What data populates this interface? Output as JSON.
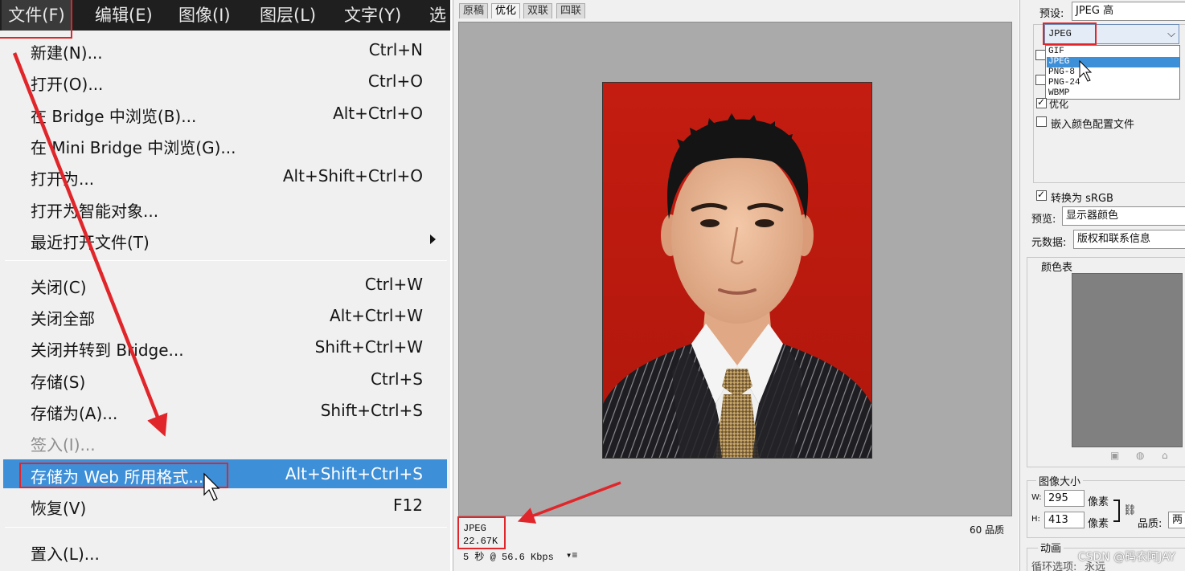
{
  "menubar": {
    "items": [
      "文件(F)",
      "编辑(E)",
      "图像(I)",
      "图层(L)",
      "文字(Y)",
      "选"
    ]
  },
  "file_menu": {
    "items": [
      {
        "label": "新建(N)...",
        "shortcut": "Ctrl+N"
      },
      {
        "label": "打开(O)...",
        "shortcut": "Ctrl+O"
      },
      {
        "label": "在 Bridge 中浏览(B)...",
        "shortcut": "Alt+Ctrl+O"
      },
      {
        "label": "在 Mini Bridge 中浏览(G)...",
        "shortcut": ""
      },
      {
        "label": "打开为...",
        "shortcut": "Alt+Shift+Ctrl+O"
      },
      {
        "label": "打开为智能对象...",
        "shortcut": ""
      },
      {
        "label": "最近打开文件(T)",
        "shortcut": ""
      },
      {
        "label": "关闭(C)",
        "shortcut": "Ctrl+W"
      },
      {
        "label": "关闭全部",
        "shortcut": "Alt+Ctrl+W"
      },
      {
        "label": "关闭并转到 Bridge...",
        "shortcut": "Shift+Ctrl+W"
      },
      {
        "label": "存储(S)",
        "shortcut": "Ctrl+S"
      },
      {
        "label": "存储为(A)...",
        "shortcut": "Shift+Ctrl+S"
      },
      {
        "label": "签入(I)...",
        "shortcut": ""
      },
      {
        "label": "存储为 Web 所用格式...",
        "shortcut": "Alt+Shift+Ctrl+S"
      },
      {
        "label": "恢复(V)",
        "shortcut": "F12"
      },
      {
        "label": "置入(L)...",
        "shortcut": ""
      }
    ]
  },
  "preview": {
    "tabs": [
      "原稿",
      "优化",
      "双联",
      "四联"
    ],
    "active_tab": "优化",
    "format": "JPEG",
    "file_size": "22.67K",
    "download_time": "5 秒 @ 56.6 Kbps",
    "quality_label": "60 品质"
  },
  "settings": {
    "preset_label": "预设:",
    "preset_value": "JPEG 高",
    "format_value": "JPEG",
    "format_options": [
      "GIF",
      "JPEG",
      "PNG-8",
      "PNG-24",
      "WBMP"
    ],
    "optimized_label": "优化",
    "embed_profile_label": "嵌入颜色配置文件",
    "convert_srgb_label": "转换为 sRGB",
    "preview_label": "预览:",
    "preview_value": "显示器颜色",
    "metadata_label": "元数据:",
    "metadata_value": "版权和联系信息",
    "color_table_label": "颜色表",
    "image_size_label": "图像大小",
    "w_label": "W:",
    "w_value": "295",
    "h_label": "H:",
    "h_value": "413",
    "px_unit": "像素",
    "quality_label": "品质:",
    "quality_value": "两",
    "animation_label": "动画",
    "loop_label": "循环选项:",
    "loop_value": "永远"
  },
  "watermark": "CSDN @码农阿JAY",
  "colors": {
    "highlight": "#3d8fd8",
    "annotation_red": "#e0262a",
    "photo_background": "#c41c10"
  }
}
